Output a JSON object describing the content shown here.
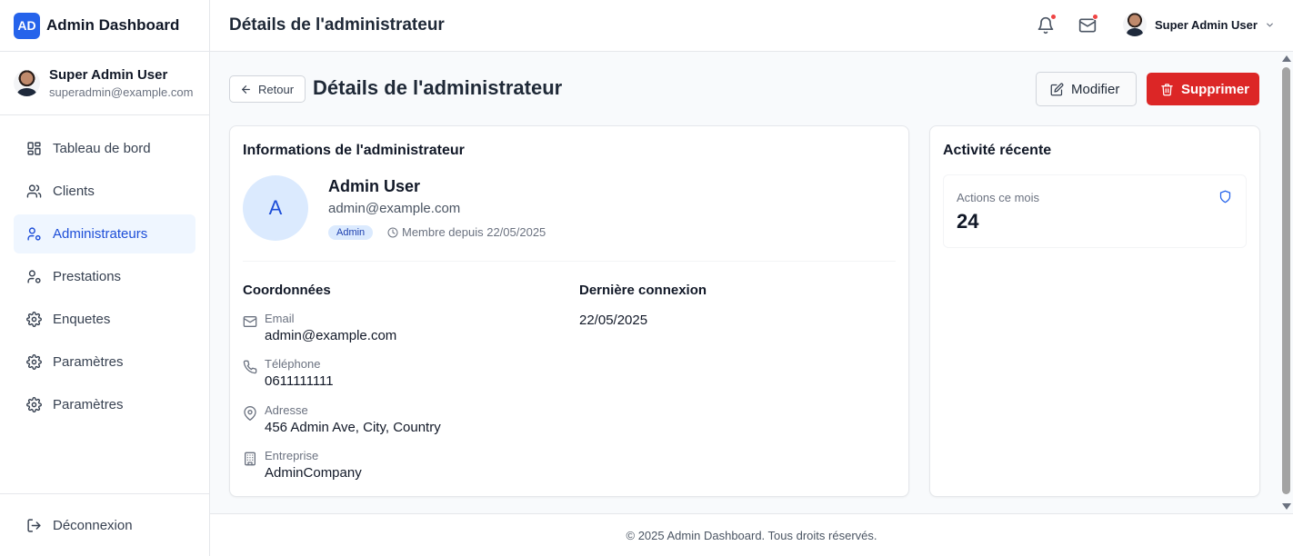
{
  "brand": {
    "logo_text": "AD",
    "name": "Admin Dashboard",
    "accent_color": "#2563eb"
  },
  "sidebar_profile": {
    "name": "Super Admin User",
    "email": "superadmin@example.com"
  },
  "nav": {
    "items": [
      {
        "label": "Tableau de bord",
        "icon": "dashboard-grid-icon"
      },
      {
        "label": "Clients",
        "icon": "users-icon"
      },
      {
        "label": "Administrateurs",
        "icon": "user-cog-icon",
        "active": true
      },
      {
        "label": "Prestations",
        "icon": "user-cog-icon"
      },
      {
        "label": "Enquetes",
        "icon": "gear-icon"
      },
      {
        "label": "Paramètres",
        "icon": "gear-icon"
      },
      {
        "label": "Paramètres",
        "icon": "gear-icon"
      }
    ],
    "logout_label": "Déconnexion"
  },
  "header": {
    "title": "Détails de l'administrateur",
    "user_name": "Super Admin User"
  },
  "page": {
    "back_label": "Retour",
    "title": "Détails de l'administrateur",
    "edit_label": "Modifier",
    "delete_label": "Supprimer",
    "delete_color": "#dc2626"
  },
  "info_card": {
    "title": "Informations de l'administrateur",
    "avatar_initial": "A",
    "name": "Admin User",
    "email": "admin@example.com",
    "role_badge": "Admin",
    "member_since": "Membre depuis 22/05/2025",
    "contact_title": "Coordonnées",
    "fields": [
      {
        "label": "Email",
        "value": "admin@example.com",
        "icon": "mail-icon"
      },
      {
        "label": "Téléphone",
        "value": "0611111111",
        "icon": "phone-icon"
      },
      {
        "label": "Adresse",
        "value": "456 Admin Ave, City, Country",
        "icon": "map-pin-icon"
      },
      {
        "label": "Entreprise",
        "value": "AdminCompany",
        "icon": "building-icon"
      }
    ],
    "last_login_title": "Dernière connexion",
    "last_login_value": "22/05/2025"
  },
  "activity_card": {
    "title": "Activité récente",
    "stat_label": "Actions ce mois",
    "stat_value": "24",
    "stat_icon": "shield-icon"
  },
  "footer": {
    "text": "© 2025 Admin Dashboard. Tous droits réservés."
  }
}
